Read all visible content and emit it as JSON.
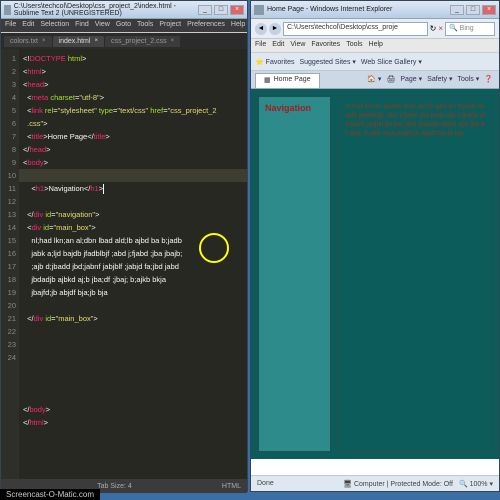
{
  "sublime": {
    "title": "C:\\Users\\techcol\\Desktop\\css_project_2\\index.html - Sublime Text 2 (UNREGISTERED)",
    "menu": [
      "File",
      "Edit",
      "Selection",
      "Find",
      "View",
      "Goto",
      "Tools",
      "Project",
      "Preferences",
      "Help"
    ],
    "tabs": [
      {
        "label": "colors.txt",
        "active": false
      },
      {
        "label": "index.html",
        "active": true
      },
      {
        "label": "css_project_2.css",
        "active": false
      }
    ],
    "code_lines": [
      {
        "n": 1,
        "html": "&lt;!<span class='t-red'>DOCTYPE</span> <span class='t-grn'>html</span>&gt;"
      },
      {
        "n": 2,
        "html": "&lt;<span class='t-red'>html</span>&gt;"
      },
      {
        "n": 3,
        "html": "&lt;<span class='t-red'>head</span>&gt;"
      },
      {
        "n": 4,
        "html": "  &lt;<span class='t-red'>meta</span> <span class='t-grn'>charset</span>=<span class='t-yel'>\"utf-8\"</span>&gt;"
      },
      {
        "n": 5,
        "html": "  &lt;<span class='t-red'>link</span> <span class='t-grn'>rel</span>=<span class='t-yel'>\"stylesheet\"</span> <span class='t-grn'>type</span>=<span class='t-yel'>\"text/css\"</span> <span class='t-grn'>href</span>=<span class='t-yel'>\"css_project_2</span>"
      },
      {
        "n": "",
        "html": "  <span class='t-yel'>.css\"</span>&gt;"
      },
      {
        "n": 6,
        "html": "  &lt;<span class='t-red'>title</span>&gt;Home Page&lt;/<span class='t-red'>title</span>&gt;"
      },
      {
        "n": 7,
        "html": "&lt;/<span class='t-red'>head</span>&gt;"
      },
      {
        "n": 8,
        "html": "&lt;<span class='t-red'>body</span>&gt;"
      },
      {
        "n": 9,
        "html": "  &lt;<span class='t-red'>div</span> <span class='t-grn'>id</span>=<span class='t-yel'>\"navigation\"</span>&gt;"
      },
      {
        "n": 10,
        "html": "    &lt;<span class='t-red'>h1</span>&gt;Navigation&lt;/<span class='t-red'>h1</span>&gt;<span class='blink'></span>"
      },
      {
        "n": 11,
        "html": ""
      },
      {
        "n": 12,
        "html": "  &lt;/<span class='t-red'>div</span> <span class='t-grn'>id</span>=<span class='t-yel'>\"navigation\"</span>&gt;"
      },
      {
        "n": 13,
        "html": "  &lt;<span class='t-red'>div</span> <span class='t-grn'>id</span>=<span class='t-yel'>\"main_box\"</span>&gt;"
      },
      {
        "n": 14,
        "html": "    nl;had lkn;an al;dbn lbad ald;lb ajbd ba b;jadb"
      },
      {
        "n": "",
        "html": "    jabk a;ljd bajdb jfadblbjf ;abd j;fjabd ;jba jbajb;"
      },
      {
        "n": "",
        "html": "    ;ajb d;jbadd jbd;jabnf jabjblf ;jabjd fa;jbd jabd"
      },
      {
        "n": "",
        "html": "    jbdadjb ajbkd aj;b jba;df ;jbaj; b;ajkb bkja"
      },
      {
        "n": "",
        "html": "    jbajfd;jb abjdf bja;jb bja"
      },
      {
        "n": 15,
        "html": ""
      },
      {
        "n": 16,
        "html": "  &lt;/<span class='t-red'>div</span> <span class='t-grn'>id</span>=<span class='t-yel'>\"main_box\"</span>&gt;"
      },
      {
        "n": 17,
        "html": ""
      },
      {
        "n": 18,
        "html": ""
      },
      {
        "n": 19,
        "html": ""
      },
      {
        "n": 20,
        "html": ""
      },
      {
        "n": 21,
        "html": ""
      },
      {
        "n": 22,
        "html": ""
      },
      {
        "n": 23,
        "html": "&lt;/<span class='t-red'>body</span>&gt;"
      },
      {
        "n": 24,
        "html": "&lt;/<span class='t-red'>html</span>&gt;"
      }
    ],
    "status_left": "",
    "status_mid": "Tab Size: 4",
    "status_right": "HTML"
  },
  "ie": {
    "title": "Home Page - Windows Internet Explorer",
    "url": "C:\\Users\\techcol\\Desktop\\css_proje",
    "search_placeholder": "Bing",
    "menu": [
      "File",
      "Edit",
      "View",
      "Favorites",
      "Tools",
      "Help"
    ],
    "favbar": {
      "fav": "Favorites",
      "sug": "Suggested Sites ▾",
      "slice": "Web Slice Gallery ▾"
    },
    "tab_label": "Home Page",
    "tools": [
      "🏠 ▾",
      "🖨",
      "Page ▾",
      "Safety ▾",
      "Tools ▾",
      "❓"
    ],
    "page": {
      "nav_heading": "Navigation",
      "main_text": "nl;had lkn;an al;dbn lbad ald;lb ajbd ba b;jadb bnajdb jbdalbdjf ;abd j;fjabd ;jba jbajb;ajb d;jbadd jbd;jabnf jabjblf;fja;jbd jabd jbdadjk ajbkd aj;b jba;df ;jbaj; b;ajkb bkja jbajfd;jb abjdf bja;jb bja"
    },
    "status": {
      "done": "Done",
      "mode": "Computer | Protected Mode: Off",
      "zoom": "100%"
    }
  },
  "watermark": "Screencast-O-Matic.com"
}
